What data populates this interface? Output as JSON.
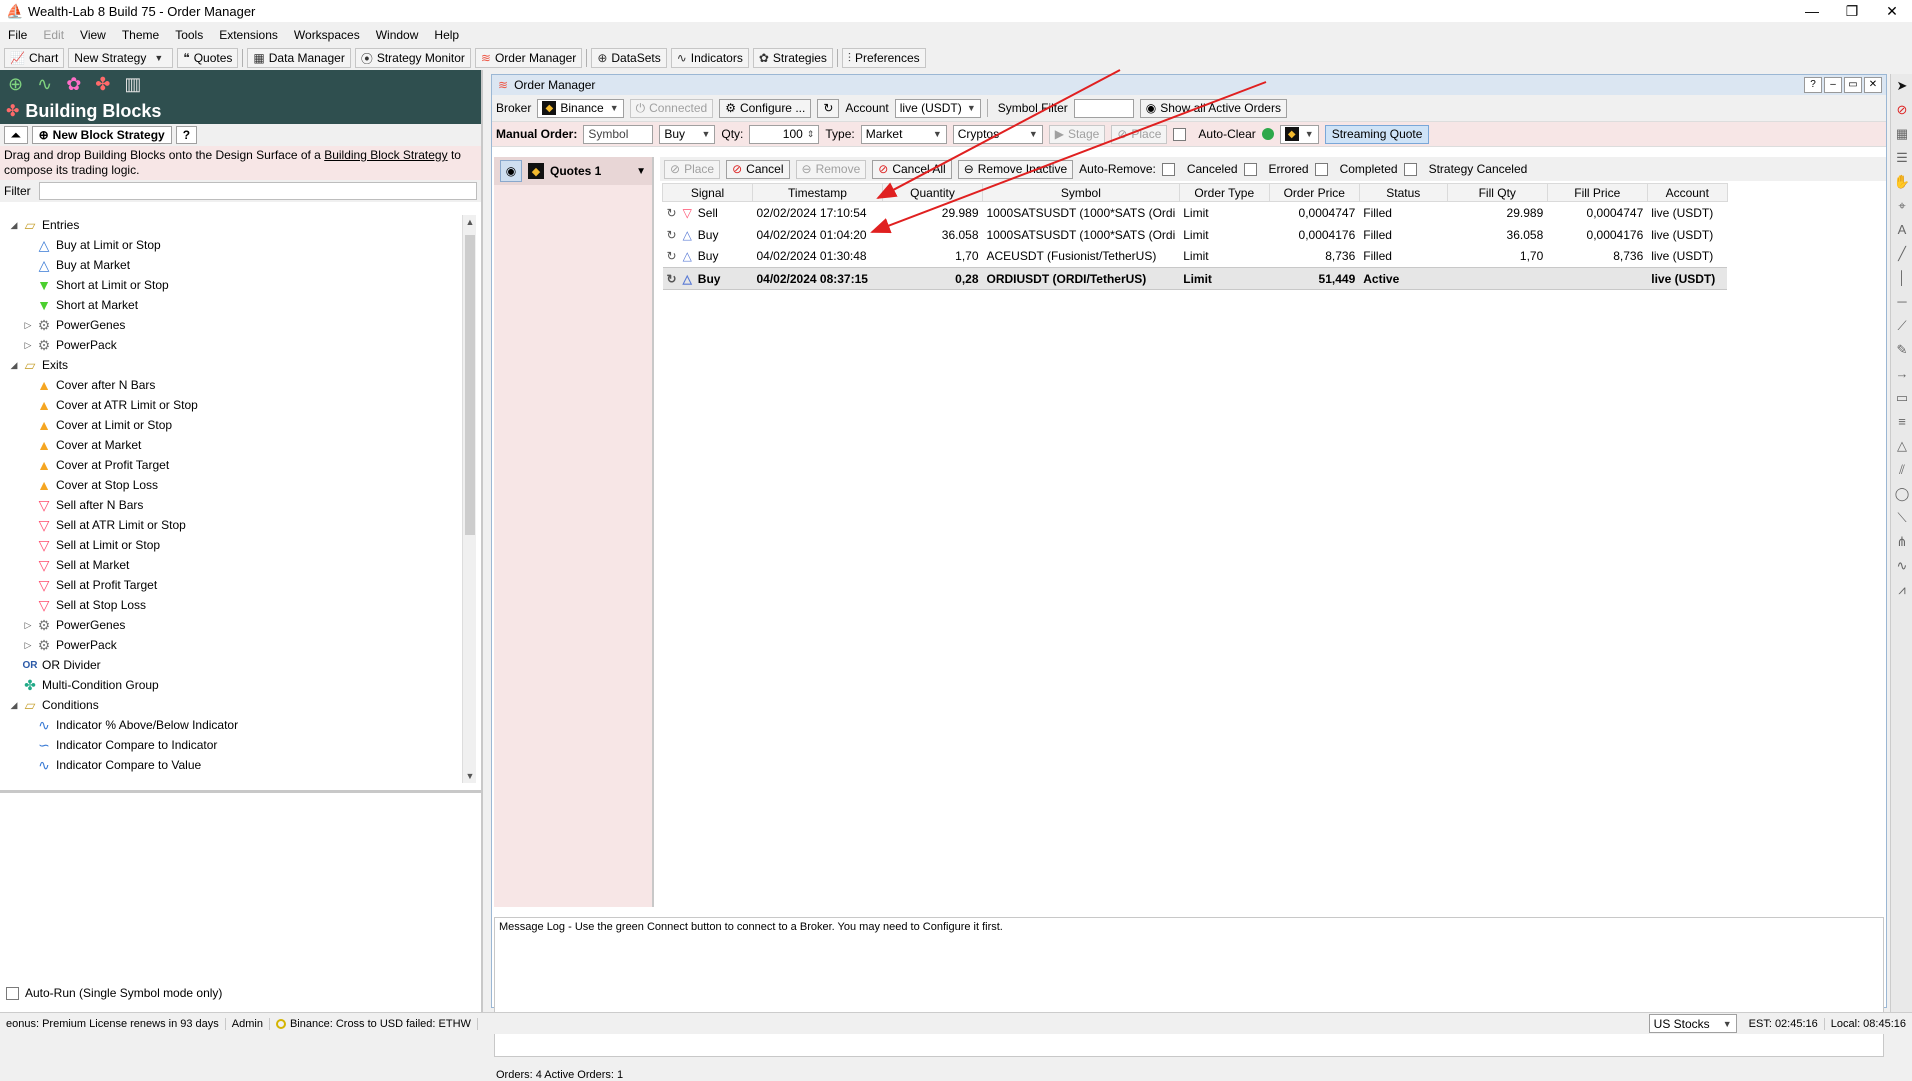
{
  "window": {
    "title": "Wealth-Lab 8 Build 75 - Order Manager",
    "min": "—",
    "max": "❐",
    "close": "✕"
  },
  "menu": [
    "File",
    "Edit",
    "View",
    "Theme",
    "Tools",
    "Extensions",
    "Workspaces",
    "Window",
    "Help"
  ],
  "toolbar": {
    "chart": "Chart",
    "new_strategy": "New Strategy",
    "quotes": "Quotes",
    "data_manager": "Data Manager",
    "strategy_monitor": "Strategy Monitor",
    "order_manager": "Order Manager",
    "datasets": "DataSets",
    "indicators": "Indicators",
    "strategies": "Strategies",
    "preferences": "Preferences"
  },
  "left": {
    "title": "Building Blocks",
    "new_block_strategy": "New Block Strategy",
    "help": "?",
    "desc_pre": "Drag and drop Building Blocks onto the Design Surface of a ",
    "desc_link": "Building Block Strategy",
    "desc_post": " to compose its trading logic.",
    "filter_label": "Filter",
    "tree": [
      {
        "label": "Entries",
        "level": 0,
        "icon": "folder-icon",
        "exp": "◢"
      },
      {
        "label": "Buy at Limit or Stop",
        "level": 1,
        "icon": "triangle-up-blue-icon"
      },
      {
        "label": "Buy at Market",
        "level": 1,
        "icon": "triangle-up-blue-icon"
      },
      {
        "label": "Short at Limit or Stop",
        "level": 1,
        "icon": "triangle-down-green-icon"
      },
      {
        "label": "Short at Market",
        "level": 1,
        "icon": "triangle-down-green-icon"
      },
      {
        "label": "PowerGenes",
        "level": 1,
        "icon": "gear-icon",
        "exp": "▷"
      },
      {
        "label": "PowerPack",
        "level": 1,
        "icon": "gear-icon",
        "exp": "▷"
      },
      {
        "label": "Exits",
        "level": 0,
        "icon": "folder-icon",
        "exp": "◢"
      },
      {
        "label": "Cover after N Bars",
        "level": 1,
        "icon": "triangle-up-orange-icon"
      },
      {
        "label": "Cover at ATR Limit or Stop",
        "level": 1,
        "icon": "triangle-up-orange-icon"
      },
      {
        "label": "Cover at Limit or Stop",
        "level": 1,
        "icon": "triangle-up-orange-icon"
      },
      {
        "label": "Cover at Market",
        "level": 1,
        "icon": "triangle-up-orange-icon"
      },
      {
        "label": "Cover at Profit Target",
        "level": 1,
        "icon": "triangle-up-orange-icon"
      },
      {
        "label": "Cover at Stop Loss",
        "level": 1,
        "icon": "triangle-up-orange-icon"
      },
      {
        "label": "Sell after N Bars",
        "level": 1,
        "icon": "triangle-down-red-icon"
      },
      {
        "label": "Sell at ATR Limit or Stop",
        "level": 1,
        "icon": "triangle-down-red-icon"
      },
      {
        "label": "Sell at Limit or Stop",
        "level": 1,
        "icon": "triangle-down-red-icon"
      },
      {
        "label": "Sell at Market",
        "level": 1,
        "icon": "triangle-down-red-icon"
      },
      {
        "label": "Sell at Profit Target",
        "level": 1,
        "icon": "triangle-down-red-icon"
      },
      {
        "label": "Sell at Stop Loss",
        "level": 1,
        "icon": "triangle-down-red-icon"
      },
      {
        "label": "PowerGenes",
        "level": 1,
        "icon": "gear-icon",
        "exp": "▷"
      },
      {
        "label": "PowerPack",
        "level": 1,
        "icon": "gear-icon",
        "exp": "▷"
      },
      {
        "label": "OR Divider",
        "level": 0,
        "icon": "or-icon"
      },
      {
        "label": "Multi-Condition Group",
        "level": 0,
        "icon": "group-icon"
      },
      {
        "label": "Conditions",
        "level": 0,
        "icon": "folder-icon",
        "exp": "◢"
      },
      {
        "label": "Indicator % Above/Below Indicator",
        "level": 1,
        "icon": "indicator-icon"
      },
      {
        "label": "Indicator Compare to Indicator",
        "level": 1,
        "icon": "indicator-compare-icon"
      },
      {
        "label": "Indicator Compare to Value",
        "level": 1,
        "icon": "indicator-icon"
      }
    ],
    "autorun": "Auto-Run (Single Symbol mode only)"
  },
  "om": {
    "title": "Order Manager",
    "broker_label": "Broker",
    "broker": "Binance",
    "connected": "Connected",
    "configure": "Configure ...",
    "account_label": "Account",
    "account": "live (USDT)",
    "symbol_filter_label": "Symbol Filter",
    "symbol_filter_value": "",
    "show_all": "Show all Active Orders",
    "manual_order": "Manual Order:",
    "symbol_placeholder": "Symbol",
    "side": "Buy",
    "qty_label": "Qty:",
    "qty": "100",
    "type_label": "Type:",
    "type": "Market",
    "asset": "Cryptos",
    "stage": "Stage",
    "place_top": "Place",
    "auto_clear": "Auto-Clear",
    "streaming_quote": "Streaming Quote",
    "quotes_tab": "Quotes 1",
    "toolbar": {
      "place": "Place",
      "cancel": "Cancel",
      "remove": "Remove",
      "cancel_all": "Cancel All",
      "remove_inactive": "Remove Inactive",
      "auto_remove": "Auto-Remove:",
      "canceled": "Canceled",
      "errored": "Errored",
      "completed": "Completed",
      "strategy_canceled": "Strategy Canceled"
    },
    "columns": [
      "Signal",
      "Timestamp",
      "Quantity",
      "Symbol",
      "Order Type",
      "Order Price",
      "Status",
      "Fill Qty",
      "Fill Price",
      "Account"
    ],
    "orders": [
      {
        "signal": "Sell",
        "timestamp": "02/02/2024 17:10:54",
        "quantity": "29.989",
        "symbol": "1000SATSUSDT (1000*SATS (Ordi",
        "order_type": "Limit",
        "order_price": "0,0004747",
        "status": "Filled",
        "fill_qty": "29.989",
        "fill_price": "0,0004747",
        "account": "live (USDT)"
      },
      {
        "signal": "Buy",
        "timestamp": "04/02/2024 01:04:20",
        "quantity": "36.058",
        "symbol": "1000SATSUSDT (1000*SATS (Ordi",
        "order_type": "Limit",
        "order_price": "0,0004176",
        "status": "Filled",
        "fill_qty": "36.058",
        "fill_price": "0,0004176",
        "account": "live (USDT)"
      },
      {
        "signal": "Buy",
        "timestamp": "04/02/2024 01:30:48",
        "quantity": "1,70",
        "symbol": "ACEUSDT (Fusionist/TetherUS)",
        "order_type": "Limit",
        "order_price": "8,736",
        "status": "Filled",
        "fill_qty": "1,70",
        "fill_price": "8,736",
        "account": "live (USDT)"
      },
      {
        "signal": "Buy",
        "timestamp": "04/02/2024 08:37:15",
        "quantity": "0,28",
        "symbol": "ORDIUSDT (ORDI/TetherUS)",
        "order_type": "Limit",
        "order_price": "51,449",
        "status": "Active",
        "fill_qty": "",
        "fill_price": "",
        "account": "live (USDT)"
      }
    ],
    "message_log": "Message Log - Use the green Connect button to connect to a Broker. You may need to Configure it first.",
    "status": "Orders: 4  Active Orders: 1"
  },
  "statusbar": {
    "license": "eonus: Premium License renews in 93 days",
    "user": "Admin",
    "binance": "Binance: Cross to USD failed: ETHW",
    "market": "US Stocks",
    "est": "EST: 02:45:16",
    "local": "Local: 08:45:16"
  },
  "colors": {
    "accent": "#2f4f4f",
    "annotation": "#e02020",
    "sell": "#ff4d6d",
    "buy": "#5a7bd5"
  }
}
